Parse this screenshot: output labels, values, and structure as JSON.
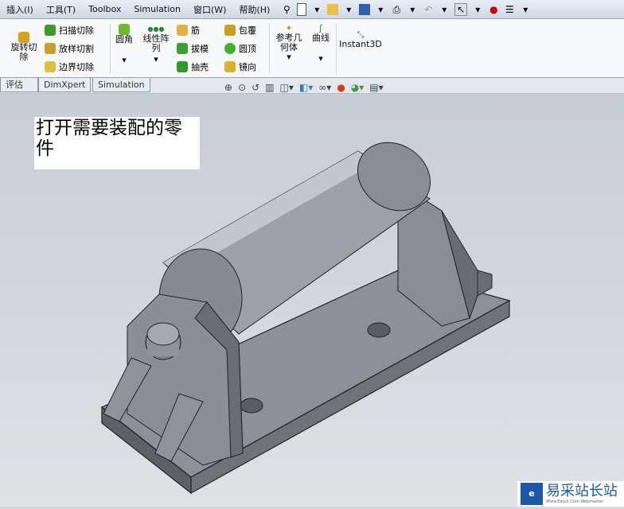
{
  "menu": [
    "插入(I)",
    "工具(T)",
    "Toolbox",
    "Simulation",
    "窗口(W)",
    "帮助(H)"
  ],
  "ribbon": {
    "revolve_cut": "旋转切除",
    "sweep_cut": "扫描切除",
    "loft_cut": "放样切割",
    "boundary_cut": "边界切除",
    "fillet": "圆角",
    "linear_pattern": "线性阵列",
    "rib": "筋",
    "draft": "拔模",
    "shell": "抽壳",
    "wrap": "包覆",
    "dome": "圆顶",
    "mirror": "镜向",
    "ref_geometry": "参考几何体",
    "curves": "曲线",
    "instant3d": "Instant3D"
  },
  "tabs": [
    "评估",
    "DimXpert",
    "Simulation"
  ],
  "note": "打开需要装配的零件",
  "watermark": {
    "text": "易采站长站",
    "sub": "Www.Easck.Com Webmaster"
  }
}
